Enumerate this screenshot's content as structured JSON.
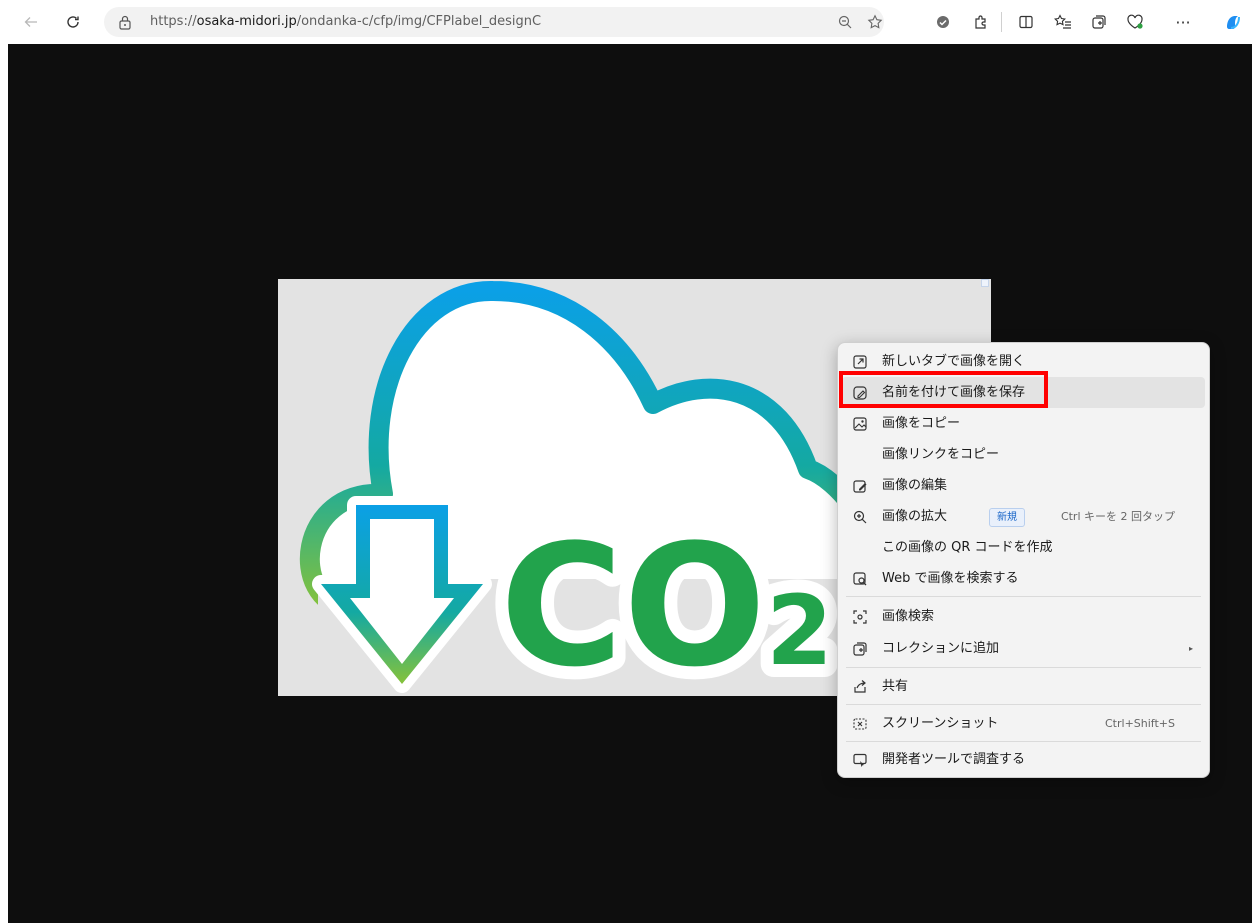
{
  "browser": {
    "url_prefix": "https://",
    "url_host": "osaka-midori.jp",
    "url_path": "/ondanka-c/cfp/img/CFPlabel_designC",
    "toolbar_icons": [
      "back-arrow-icon",
      "refresh-icon",
      "lock-icon",
      "zoom-out-icon",
      "favorite-star-icon",
      "tracking-shield-icon",
      "extensions-icon",
      "split-screen-icon",
      "favorites-list-icon",
      "collections-icon",
      "browser-essentials-icon",
      "more-dots-icon",
      "copilot-icon"
    ],
    "more_label": "···"
  },
  "image": {
    "logo_text": "CO2",
    "colors": {
      "green": "#22a34c",
      "blue": "#0ba0e6",
      "teal": "#14a9a2",
      "lime": "#86c23a"
    }
  },
  "context_menu": {
    "items": [
      {
        "label": "新しいタブで画像を開く",
        "icon": "new-tab-icon"
      },
      {
        "label": "名前を付けて画像を保存",
        "icon": "save-image-icon",
        "highlighted": true
      },
      {
        "label": "画像をコピー",
        "icon": "copy-image-icon"
      },
      {
        "label": "画像リンクをコピー",
        "icon": ""
      },
      {
        "label": "画像の編集",
        "icon": "edit-image-icon"
      },
      {
        "label": "画像の拡大",
        "icon": "zoom-in-icon",
        "badge": "新規",
        "shortcut": "Ctrl キーを 2 回タップ"
      },
      {
        "label": "この画像の QR コードを作成",
        "icon": ""
      },
      {
        "label": "Web で画像を検索する",
        "icon": "visual-search-icon"
      },
      {
        "label": "画像検索",
        "icon": "image-search-icon"
      },
      {
        "label": "コレクションに追加",
        "icon": "collections-icon",
        "submenu": "▸"
      },
      {
        "label": "共有",
        "icon": "share-icon"
      },
      {
        "label": "スクリーンショット",
        "icon": "screenshot-icon",
        "shortcut": "Ctrl+Shift+S"
      },
      {
        "label": "開発者ツールで調査する",
        "icon": "devtools-icon"
      }
    ],
    "highlight_color": "#ff0000"
  }
}
